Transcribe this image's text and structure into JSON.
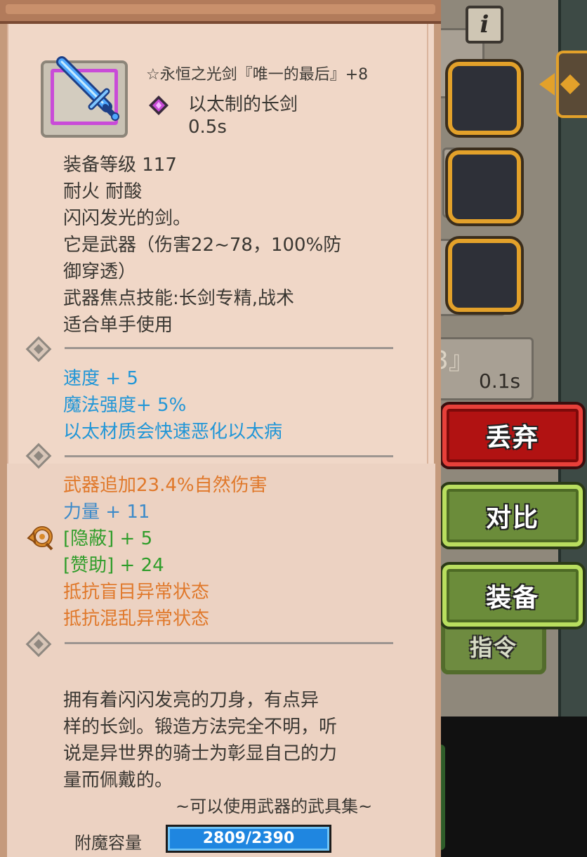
{
  "item": {
    "name": "☆永恒之光剑『唯一的最后』+8",
    "subtype": "以太制的长剑",
    "speed": "0.5s",
    "icon": "blue-sword-icon",
    "rarity_color": "#c94bd8"
  },
  "info": {
    "level": "装备等级 117",
    "resist": "耐火  耐酸",
    "flavor_short": "闪闪发光的剑。",
    "weapon_line_1": "它是武器（伤害22~78，100%防",
    "weapon_line_2": "御穿透）",
    "skill": "武器焦点技能:长剑专精,战术",
    "hand": "适合单手使用"
  },
  "enchant_blue": [
    "速度 + 5",
    "魔法强度+ 5%",
    "以太材质会快速恶化以太病"
  ],
  "enchant_extra": {
    "dmg": "武器追加23.4%自然伤害",
    "str": "力量 + 11",
    "stealth": "[隐蔽] + 5",
    "support": "[赞助] + 24",
    "resist_blind": "抵抗盲目异常状态",
    "resist_confuse": "抵抗混乱异常状态"
  },
  "description": {
    "line1": "    拥有着闪闪发亮的刀身，有点异",
    "line2": "样的长剑。锻造方法完全不明，听",
    "line3": "说是异世界的骑士为彰显自己的力",
    "line4": "量而佩戴的。",
    "source": "~可以使用武器的武具集~"
  },
  "capacity": {
    "label": "附魔容量",
    "text": "2809/2390",
    "fraction": 1.0
  },
  "buttons": {
    "discard": "丢弃",
    "compare": "对比",
    "equip": "装备",
    "command": "指令"
  },
  "background": {
    "info_glyph": "i",
    "speed_text": "0.1s",
    "bracket": "3』"
  },
  "colors": {
    "parchment": "#f0d7c7",
    "enchant_blue": "#2196d7",
    "enchant_orange": "#e0782a",
    "enchant_green": "#2f9d2a",
    "slot_border": "#e3a12a",
    "discard_red": "#b11212",
    "button_green": "#6b8c3a"
  }
}
